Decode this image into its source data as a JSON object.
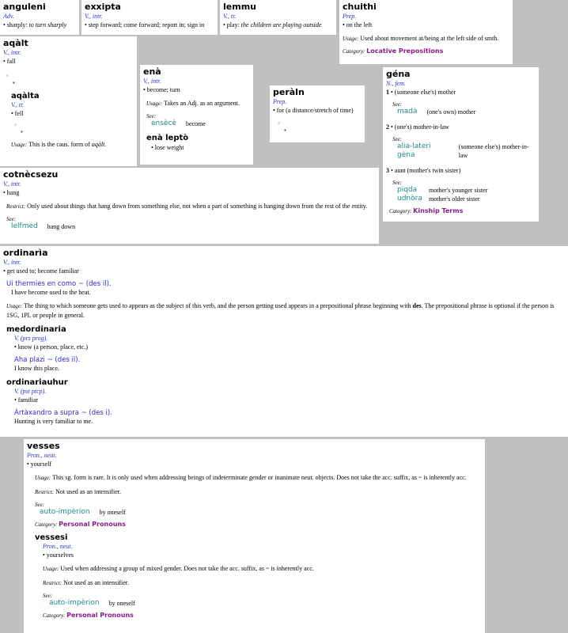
{
  "anguleni": {
    "hw": "anguleni",
    "pos": "Adv.",
    "def_pre": "• sharply: ",
    "def_it": "to turn sharply"
  },
  "exxipta": {
    "hw": "exxipta",
    "pos": "V., intr.",
    "def": "• step forward; come forward; report in; sign in"
  },
  "lemmu": {
    "hw": "lemmu",
    "pos": "V., tr.",
    "def_pre": "• play: ",
    "def_it": "the children are playing outside"
  },
  "chuithi": {
    "hw": "chuithi",
    "pos": "Prep.",
    "def": "• on the left",
    "usage_label": "Usage:",
    "usage": " Used about movement at/being at the left side of smth.",
    "cat_label": "Category:",
    "cat": "Locative Prepositions"
  },
  "aqalt": {
    "hw": "aqàlt",
    "pos": "V., intr.",
    "def": "• fall",
    "b1": "◦",
    "b2": "▪",
    "sub": "aqàlta",
    "sub_pos": "V., tr.",
    "sub_def": "• fell",
    "sb1": "◦",
    "sb2": "▪",
    "usage_label": "Usage:",
    "usage": " This is the caus. form of ",
    "usage_it": "aqàlt."
  },
  "ena": {
    "hw": "enà",
    "pos": "V., intr.",
    "def": "• become; turn",
    "usage_label": "Usage:",
    "usage": " Takes an Adj. as an argument.",
    "see_label": "See:",
    "see_w": "ensècè",
    "see_g": "become",
    "sub": "enà leptò",
    "sub_def": "• lose weight"
  },
  "peraln": {
    "hw": "peràln",
    "pos": "Prep.",
    "def": "• for (a distance/stretch of time)",
    "b1": "◦",
    "b2": "▪"
  },
  "gena": {
    "hw": "géna",
    "pos": "N., fem.",
    "s1n": "1",
    "s1": " • (someone else's) mother",
    "see1_label": "See:",
    "see1_w": "madà",
    "see1_g": "(one's own) mother",
    "s2n": "2",
    "s2": " • (one's) mother-in-law",
    "see2_label": "See:",
    "see2_w": "alia-lateri gèna",
    "see2_g": "(someone else's) mother-in-law",
    "s3n": "3",
    "s3": " • aunt (mother's twin sister)",
    "see3_label": "See:",
    "see3_w1": "piqda",
    "see3_g1": "mother's younger sister",
    "see3_w2": "udnòra",
    "see3_g2": "mother's older sister",
    "cat_label": "Category:",
    "cat": "Kinship Terms"
  },
  "cotnecsezu": {
    "hw": "cotnècsezu",
    "pos": "V., intr.",
    "def": "• hang",
    "restrict_label": "Restrict:",
    "restrict": " Only used about things that hang down from something else, not when a part of something is hanging down from the rest of the entity.",
    "see_label": "See:",
    "see_w": "lelfmed",
    "see_g": "hang down"
  },
  "ordinaria": {
    "hw": "ordinarìa",
    "pos": "V., intr.",
    "def": "• get used to; become familiar",
    "ex": "Ui thermies en como ~ (des il).",
    "ex_tr": "I have become used to the heat.",
    "usage_label": "Usage:",
    "usage1": " The thing to which someone gets used to appears as the subject of this verb, and the person getting used appears in a prepositional phrase beginning with ",
    "usage_b": "des",
    "usage2": ". The prepositional phrase is optional if the person is 1SG, 1PL or people in general.",
    "sub1": "medordinaria",
    "sub1_pos": "V. (prs prog).",
    "sub1_def": "• know (a person, place, etc.)",
    "sub1_ex": "Aha plazi ~ (des il).",
    "sub1_tr": "I know this place.",
    "sub2": "ordinariauhur",
    "sub2_pos": "V. (pst ptcp).",
    "sub2_def": "• familiar",
    "sub2_ex": "Àrtàxandro a supra ~ (des i).",
    "sub2_tr": "Hunting is very familiar to me."
  },
  "vesses": {
    "hw": "vesses",
    "pos": "Pron., neut.",
    "def": "• yourself",
    "usage_label": "Usage:",
    "usage": " This sg. form is rare. It is only used when addressing beings of indeterminate gender or inanimate neut. objects. Does not take the acc. suffix, as ~ is inherently acc.",
    "restrict_label": "Restrict:",
    "restrict": " Not used as an intensifier.",
    "see_label": "See:",
    "see_w": "auto-impèrion",
    "see_g": "by oneself",
    "cat_label": "Category:",
    "cat": "Personal Pronouns",
    "sub": "vessesi",
    "sub_pos": "Pron., neut.",
    "sub_def": "• yourselves",
    "sub_usage": " Used when addressing a group of mixed gender. Does not take the acc. suffix, as ~ is inherently acc.",
    "sub_restrict": " Not used as an intensifier.",
    "sub_see_w": "auto-impèrion",
    "sub_see_g": "by oneself",
    "sub_cat": "Personal Pronouns"
  }
}
